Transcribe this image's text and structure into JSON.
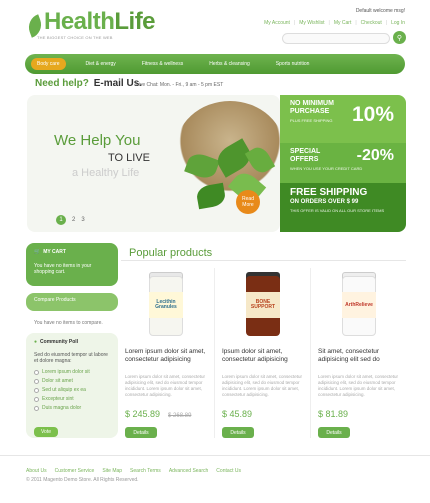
{
  "header": {
    "logo_text_1": "Health",
    "logo_text_2": "Life",
    "tagline": "THE BIGGEST CHOICE ON THE WEB",
    "welcome": "Default welcome msg!",
    "links": [
      "My Account",
      "My Wishlist",
      "My Cart",
      "Checkout",
      "Log In"
    ]
  },
  "nav": {
    "items": [
      "Body care",
      "Diet & energy",
      "Fitness & wellness",
      "Herbs & cleansing",
      "Sports nutrition"
    ]
  },
  "help": {
    "need_help": "Need help?",
    "email": "E-mail Us.",
    "live_chat": "Live Chat: Mon. - Fri., 9 am - 5 pm EST"
  },
  "banner": {
    "line1": "We Help You",
    "line2": "TO LIVE",
    "line3": "a Healthy Life",
    "read_more": "Read More",
    "pages": [
      "1",
      "2",
      "3"
    ]
  },
  "promos": [
    {
      "label": "NO MINIMUM PURCHASE",
      "big": "10%",
      "sub": "PLUS FREE SHIPPING"
    },
    {
      "label": "SPECIAL OFFERS",
      "big": "-20%",
      "sub": "WHEN YOU USE YOUR CREDIT CARD"
    },
    {
      "label": "FREE SHIPPING",
      "label2": "ON ORDERS OVER $ 99",
      "sub": "THIS OFFER IS VALID ON ALL OUR STORE ITEMS"
    }
  ],
  "sidebar": {
    "cart_title": "MY CART",
    "cart_text": "You have no items in your shopping cart.",
    "compare_title": "Compare Products",
    "compare_text": "You have no items to compare.",
    "poll_title": "Community Poll",
    "poll_question": "Sed do eiusmod tempor ut labore et dolore magna:",
    "poll_options": [
      "Lorem ipsum dolor sit",
      "Dolor sit amet",
      "Sed ut aliquip ex ea",
      "Excepteur sint",
      "Duis magna dolor"
    ],
    "vote": "Vote"
  },
  "products": {
    "heading": "Popular products",
    "items": [
      {
        "name": "Lorem ipsum dolor sit amet, consectetur adipisicing",
        "desc": "Lorem ipsum dolor sit amet, consectetur adipisicing elit, sed do eiusmod tempor incididunt. Lorem ipsum dolor sit amet, consectetur adipisicing.",
        "price": "$ 245.89",
        "old_price": "$ 268.89",
        "label": "Lecithin Granules",
        "details": "Details"
      },
      {
        "name": "Ipsum dolor sit amet, consectetur adipisicing",
        "desc": "Lorem ipsum dolor sit amet, consectetur adipisicing elit, sed do eiusmod tempor incididunt. Lorem ipsum dolor sit amet, consectetur adipisicing.",
        "price": "$ 45.89",
        "old_price": "",
        "label": "BONE SUPPORT",
        "details": "Details"
      },
      {
        "name": "Sit amet, consectetur adipisicing elit sed do",
        "desc": "Lorem ipsum dolor sit amet, consectetur adipisicing elit, sed do eiusmod tempor incididunt. Lorem ipsum dolor sit amet, consectetur adipisicing.",
        "price": "$ 81.89",
        "old_price": "",
        "label": "ArthRelieve",
        "details": "Details"
      }
    ]
  },
  "footer": {
    "links": [
      "About Us",
      "Customer Service",
      "Site Map",
      "Search Terms",
      "Advanced Search",
      "Contact Us"
    ],
    "copyright": "© 2011 Magento Demo Store. All Rights Reserved."
  },
  "colors": {
    "brand": "#6ab04c",
    "accent": "#e6a81e",
    "dark_green": "#3f8a24"
  }
}
